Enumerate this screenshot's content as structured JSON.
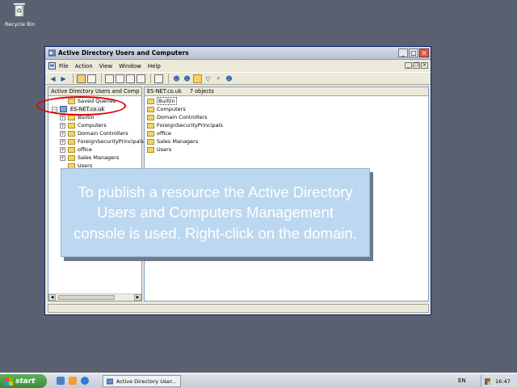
{
  "desktop": {
    "recycle_bin_label": "Recycle Bin"
  },
  "window": {
    "title": "Active Directory Users and Computers",
    "controls": {
      "minimize": "_",
      "maximize": "□",
      "close": "×"
    }
  },
  "menu": {
    "items": [
      "File",
      "Action",
      "View",
      "Window",
      "Help"
    ]
  },
  "tree": {
    "header": "Active Directory Users and Comp",
    "items": [
      {
        "label": "Saved Queries",
        "expander": ""
      },
      {
        "label": "ES-NET.co.uk",
        "expander": "−"
      },
      {
        "label": "Builtin",
        "expander": "+"
      },
      {
        "label": "Computers",
        "expander": "+"
      },
      {
        "label": "Domain Controllers",
        "expander": "+"
      },
      {
        "label": "ForeignSecurityPrincipals",
        "expander": "+"
      },
      {
        "label": "office",
        "expander": "+"
      },
      {
        "label": "Sales Managers",
        "expander": "+"
      },
      {
        "label": "Users",
        "expander": ""
      }
    ]
  },
  "list": {
    "header_domain": "ES-NET.co.uk",
    "header_count": "7 objects",
    "items": [
      "Builtin",
      "Computers",
      "Domain Controllers",
      "ForeignSecurityPrincipals",
      "office",
      "Sales Managers",
      "Users"
    ]
  },
  "callout": {
    "text": "To publish a resource the Active Directory Users and Computers Management console is used. Right-click on the domain."
  },
  "taskbar": {
    "start_label": "start",
    "task_label": "Active Directory User...",
    "language": "EN",
    "clock": "16:47"
  },
  "colors": {
    "annotation": "#e00000",
    "callout_bg": "#bcd8f0",
    "desktop": "#5a6070"
  }
}
